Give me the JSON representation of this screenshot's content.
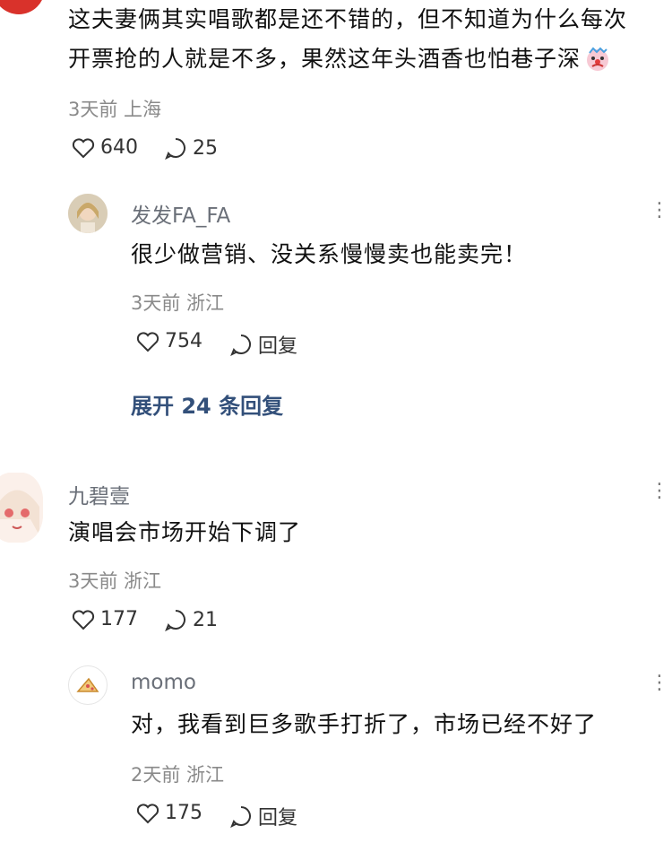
{
  "comments": [
    {
      "text_line1": "这夫妻俩其实唱歌都是还不错的，但不知道为什么每次",
      "text_line2": "开票抢的人就是不多，果然这年头酒香也怕巷子深",
      "emoji": "clown-crying-emoji",
      "meta": "3天前 上海",
      "likes": "640",
      "replies": "25",
      "reply": {
        "username": "发发FA_FA",
        "text": "很少做营销、没关系慢慢卖也能卖完！",
        "meta": "3天前 浙江",
        "likes": "754",
        "reply_label": "回复"
      },
      "expand_label": "展开 24 条回复"
    },
    {
      "username": "九碧壹",
      "text": "演唱会市场开始下调了",
      "meta": "3天前 浙江",
      "likes": "177",
      "replies": "21",
      "reply": {
        "username": "momo",
        "text": "对，我看到巨多歌手打折了，市场已经不好了",
        "meta": "2天前 浙江",
        "likes": "175",
        "reply_label": "回复"
      }
    }
  ],
  "more_glyph": "⋮",
  "colors": {
    "accent_link": "#33507a",
    "meta": "#8a8a8a",
    "avatar_red": "#d9322b"
  }
}
